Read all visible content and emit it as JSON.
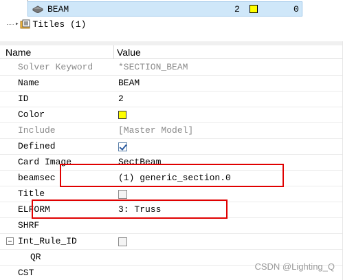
{
  "tree": {
    "beam_row": {
      "label": "BEAM",
      "id": "2",
      "count": "0",
      "color": "#ffff00"
    },
    "titles_row": {
      "label": "Titles (1)"
    }
  },
  "table": {
    "header": {
      "name": "Name",
      "value": "Value"
    },
    "rows": [
      {
        "name": "Solver Keyword",
        "value": "*SECTION_BEAM",
        "kind": "text",
        "dim": true
      },
      {
        "name": "Name",
        "value": "BEAM",
        "kind": "text",
        "dim": false
      },
      {
        "name": "ID",
        "value": "2",
        "kind": "text",
        "dim": false
      },
      {
        "name": "Color",
        "value": "#ffff00",
        "kind": "color",
        "dim": false
      },
      {
        "name": "Include",
        "value": "[Master Model]",
        "kind": "text",
        "dim": true
      },
      {
        "name": "Defined",
        "value": true,
        "kind": "checkbox",
        "dim": false
      },
      {
        "name": "Card Image",
        "value": "SectBeam",
        "kind": "text",
        "dim": false
      },
      {
        "name": "beamsec",
        "value": "(1) generic_section.0",
        "kind": "text",
        "dim": false
      },
      {
        "name": "Title",
        "value": false,
        "kind": "checkbox",
        "dim": false
      },
      {
        "name": "ELFORM",
        "value": "3: Truss",
        "kind": "text",
        "dim": false
      },
      {
        "name": "SHRF",
        "value": "",
        "kind": "text",
        "dim": false
      },
      {
        "name": "Int_Rule_ID",
        "value": false,
        "kind": "checkbox",
        "dim": false,
        "expander": true
      },
      {
        "name": "QR",
        "value": "",
        "kind": "text",
        "dim": false,
        "indent": true
      },
      {
        "name": "CST",
        "value": "",
        "kind": "text",
        "dim": false
      }
    ]
  },
  "watermark": "CSDN @Lighting_Q",
  "colors": {
    "selection": "#cfe7f9",
    "annotation": "#e00000",
    "swatch": "#ffff00"
  }
}
